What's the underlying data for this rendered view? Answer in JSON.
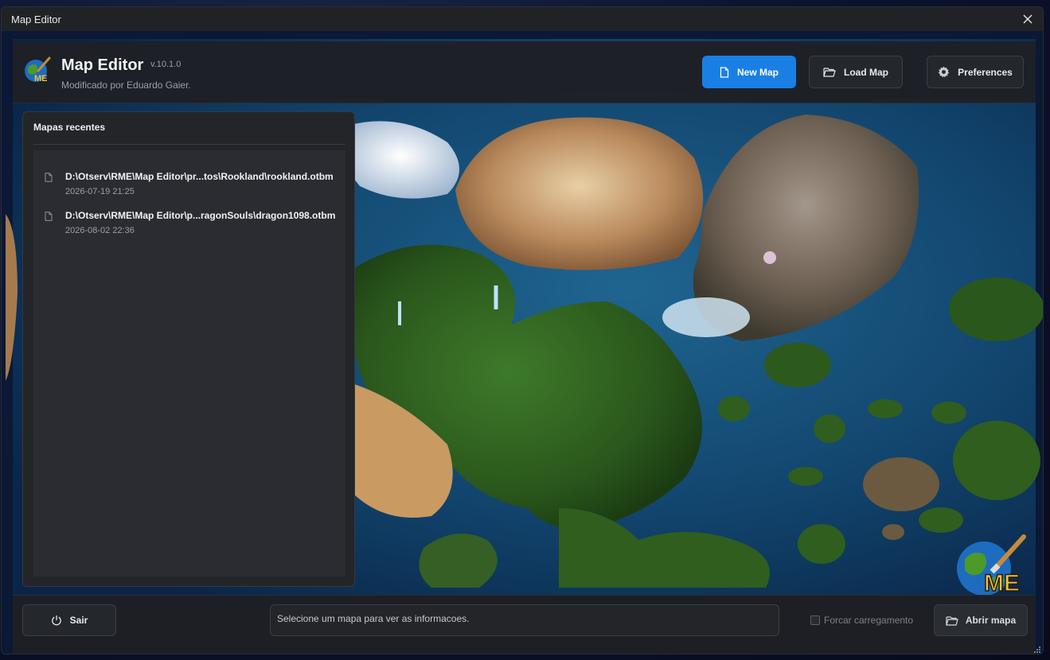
{
  "window": {
    "title": "Map Editor"
  },
  "header": {
    "app_name": "Map Editor",
    "version": "v.10.1.0",
    "subtitle": "Modificado por Eduardo Gaier.",
    "buttons": {
      "new_map": "New Map",
      "load_map": "Load Map",
      "preferences": "Preferences"
    }
  },
  "recent": {
    "title": "Mapas recentes",
    "items": [
      {
        "path": "D:\\Otserv\\RME\\Map Editor\\pr...tos\\Rookland\\rookland.otbm",
        "date": "2026-07-19 21:25"
      },
      {
        "path": "D:\\Otserv\\RME\\Map Editor\\p...ragonSouls\\dragon1098.otbm",
        "date": "2026-08-02 22:36"
      }
    ]
  },
  "footer": {
    "exit_label": "Sair",
    "info_text": "Selecione um mapa para ver as informacoes.",
    "force_load_label": "Forcar carregamento",
    "force_load_checked": false,
    "open_label": "Abrir mapa"
  },
  "logo": {
    "text": "ME"
  },
  "colors": {
    "accent": "#1a7fe4",
    "panel": "#232529",
    "ocean": "#0f3f6b",
    "forest": "#2f5e1f",
    "sand": "#c99a62"
  },
  "icons": {
    "new_map": "file-icon",
    "load_map": "folder-open-icon",
    "preferences": "gear-icon",
    "exit": "power-icon",
    "open": "folder-open-icon",
    "recent_item": "file-icon",
    "close": "close-icon"
  }
}
